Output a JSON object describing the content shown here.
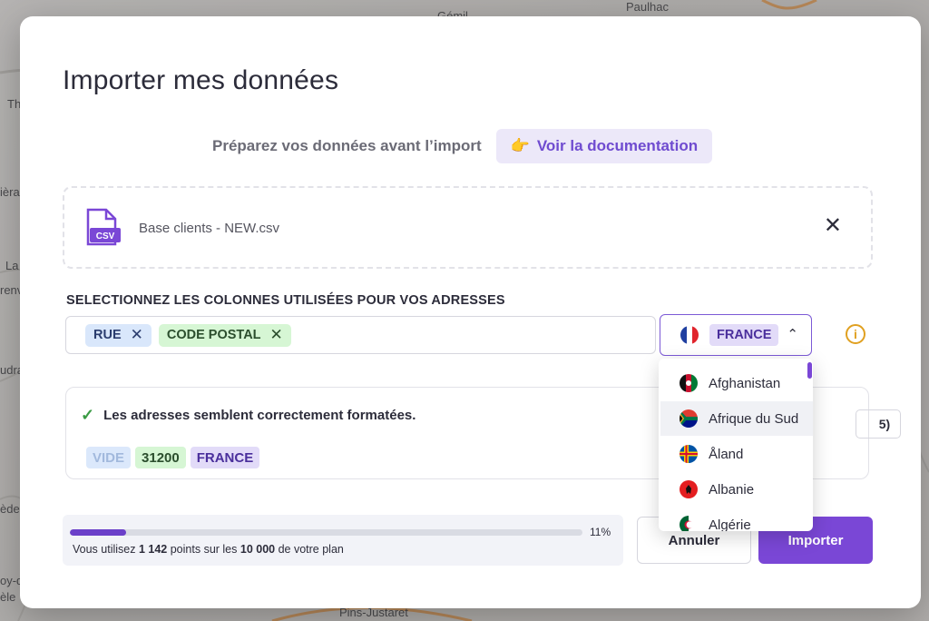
{
  "map": {
    "labels": [
      "Paulhac",
      "Gémil",
      "Thil",
      "ièra",
      "La",
      "renv",
      "udra",
      "ède",
      "oy-d",
      "èle",
      "Pins-Justaret"
    ]
  },
  "modal": {
    "title": "Importer mes données",
    "prepare_text": "Préparez vos données avant l’import",
    "doc_button": "Voir la documentation",
    "doc_icon": "pointing-hand",
    "file": {
      "icon": "csv-file-icon",
      "icon_label": "CSV",
      "name": "Base clients - NEW.csv",
      "close": "✕"
    },
    "columns_label": "SELECTIONNEZ LES COLONNES UTILISÉES POUR VOS ADRESSES",
    "columns": [
      {
        "label": "RUE",
        "remove": "✕"
      },
      {
        "label": "CODE POSTAL",
        "remove": "✕"
      }
    ],
    "country": {
      "selected": "FRANCE",
      "chevron": "⌃",
      "info": "i"
    },
    "result": {
      "message": "Les adresses semblent correctement formatées.",
      "preview": [
        "VIDE",
        "31200",
        "FRANCE"
      ],
      "page_count": "5)"
    },
    "usage": {
      "progress": 0.11,
      "percent_label": "11%",
      "text_prefix": "Vous utilisez",
      "used": "1 142",
      "text_middle": "points sur les",
      "total": "10 000",
      "text_suffix": "de votre plan"
    },
    "cancel_button": "Annuler",
    "import_button": "Importer"
  },
  "dropdown": {
    "items": [
      {
        "name": "Afghanistan",
        "flag": "af"
      },
      {
        "name": "Afrique du Sud",
        "flag": "za"
      },
      {
        "name": "Åland",
        "flag": "ax"
      },
      {
        "name": "Albanie",
        "flag": "al"
      },
      {
        "name": "Algérie",
        "flag": "dz"
      }
    ]
  },
  "colors": {
    "accent": "#7a47d6",
    "tag_blue": "#d9e7fb",
    "tag_green": "#d6f6d4",
    "tag_purple": "#e2dbf8",
    "success": "#3a9b44",
    "warning": "#e0a020"
  }
}
